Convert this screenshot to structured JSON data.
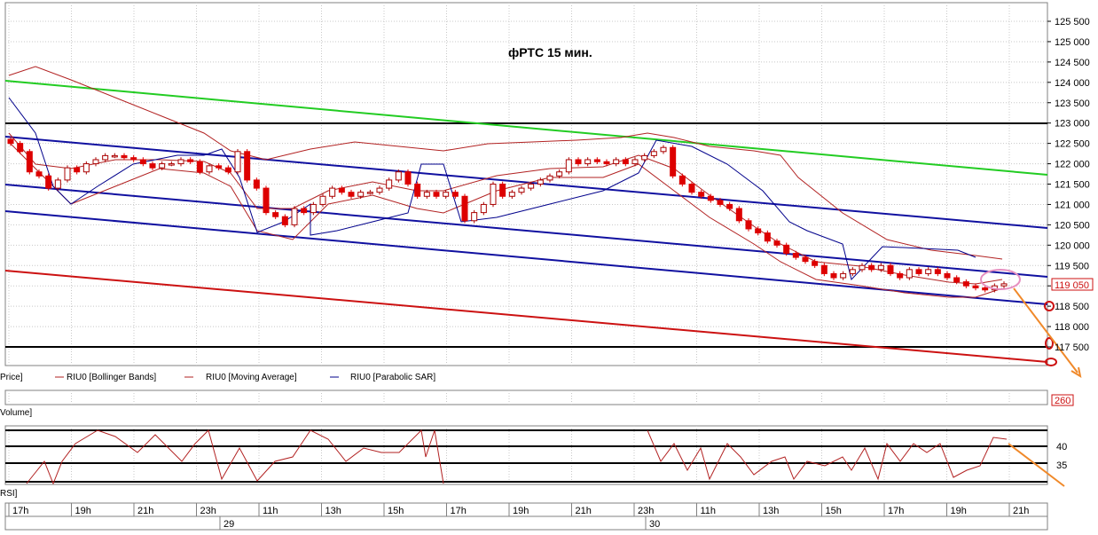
{
  "chart_data": {
    "type": "candlestick",
    "title": "фРТС   15 мин.",
    "instrument": "RIU0",
    "price_axis": {
      "ticks": [
        "125 500",
        "125 000",
        "124 500",
        "124 000",
        "123 500",
        "123 000",
        "122 500",
        "122 000",
        "121 500",
        "121 000",
        "120 500",
        "120 000",
        "119 500",
        "119 000",
        "118 500",
        "118 000",
        "117 500"
      ],
      "ylim": [
        117100,
        125700
      ],
      "last_price": "119 050",
      "grid": true
    },
    "legend": [
      {
        "label": "Price]",
        "color": "#000000"
      },
      {
        "label": "RIU0 [Bollinger Bands]",
        "color": "#b22222"
      },
      {
        "label": "RIU0 [Moving Average]",
        "color": "#b22222"
      },
      {
        "label": "RIU0 [Parabolic SAR]",
        "color": "#00008b"
      }
    ],
    "volume_panel": {
      "label": "Volume]",
      "value_box": "260"
    },
    "rsi_panel": {
      "label": "RSI]",
      "ticks": [
        "40",
        "35"
      ]
    },
    "time_axis": {
      "hours": [
        "17h",
        "19h",
        "21h",
        "23h",
        "11h",
        "13h",
        "15h",
        "17h",
        "19h",
        "21h",
        "23h",
        "11h",
        "13h",
        "15h",
        "17h",
        "19h",
        "21h"
      ],
      "days": [
        "29",
        "30"
      ]
    },
    "candles": [
      122500,
      122300,
      121800,
      121700,
      121400,
      121600,
      121900,
      121800,
      122000,
      122100,
      122200,
      122200,
      122150,
      122100,
      122000,
      121900,
      122000,
      122000,
      122100,
      122050,
      121800,
      121950,
      121900,
      121800,
      122300,
      121600,
      121400,
      120800,
      120700,
      120500,
      120900,
      120800,
      121000,
      121200,
      121400,
      121300,
      121200,
      121300,
      121300,
      121400,
      121600,
      121800,
      121500,
      121200,
      121300,
      121200,
      121300,
      121200,
      120600,
      120800,
      121000,
      121500,
      121200,
      121300,
      121400,
      121500,
      121600,
      121700,
      121800,
      122100,
      122000,
      122100,
      122050,
      122000,
      122100,
      122000,
      122100,
      122200,
      122300,
      122400,
      121700,
      121500,
      121300,
      121200,
      121100,
      121000,
      120900,
      120600,
      120400,
      120300,
      120100,
      120000,
      119800,
      119700,
      119600,
      119500,
      119300,
      119200,
      119300,
      119400,
      119500,
      119400,
      119500,
      119300,
      119200,
      119400,
      119300,
      119400,
      119300,
      119200,
      119100,
      119000,
      118950,
      118900,
      119000,
      119050
    ],
    "annotations": {
      "levels": [
        123000,
        117500
      ],
      "channel_lines": [
        "green resistance",
        "blue channel top",
        "blue channel middle",
        "blue channel bottom",
        "red support"
      ],
      "circle_markers": [
        118500,
        117600,
        117100
      ],
      "arrows": "orange down arrows in price and RSI panels"
    }
  }
}
